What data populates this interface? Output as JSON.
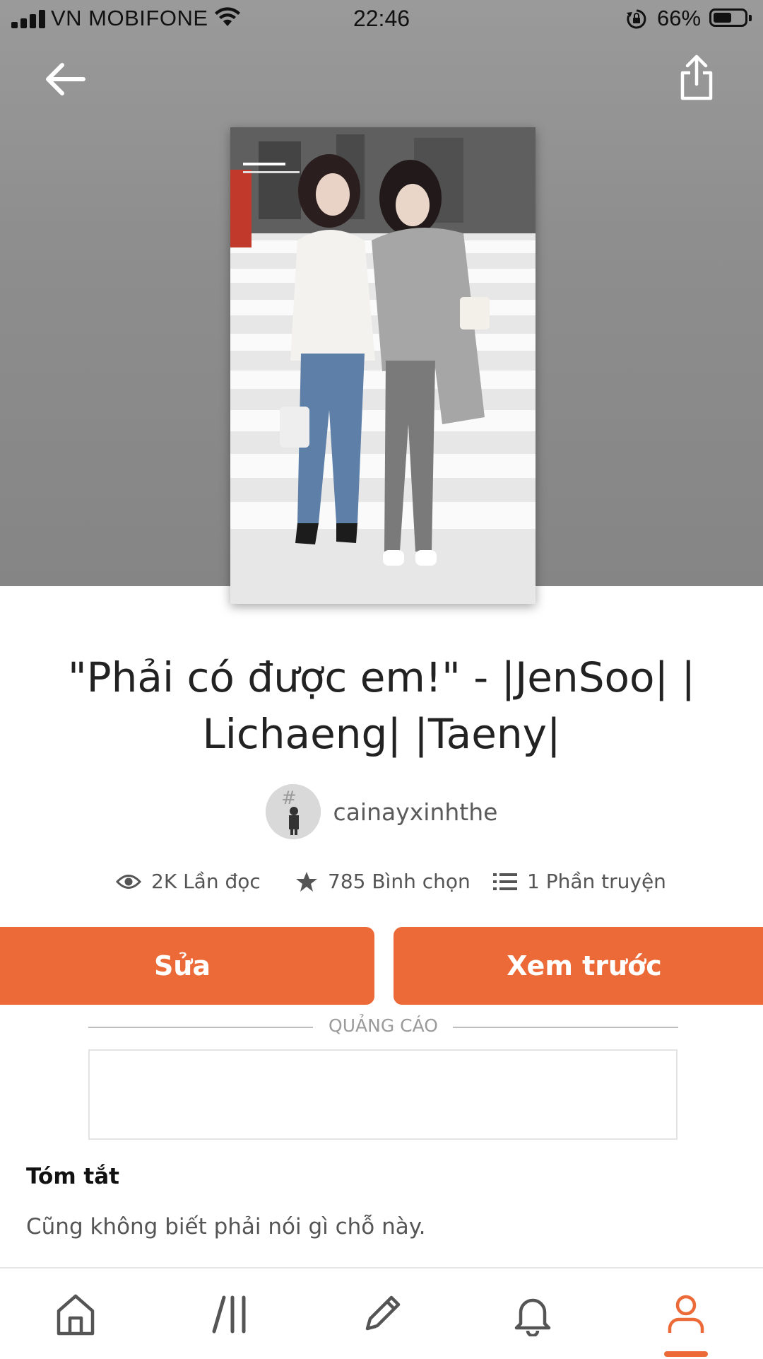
{
  "status_bar": {
    "carrier": "VN MOBIFONE",
    "time": "22:46",
    "battery_percent": "66%",
    "battery_level": 0.66
  },
  "story": {
    "title": "\"Phải có được em!\" - |JenSoo| | Lichaeng| |Taeny|",
    "author": "cainayxinhthe",
    "stats": {
      "reads": "2K Lần đọc",
      "votes": "785 Bình chọn",
      "parts": "1 Phần truyện"
    }
  },
  "actions": {
    "edit_label": "Sửa",
    "preview_label": "Xem trước"
  },
  "ad": {
    "label": "QUẢNG CÁO"
  },
  "summary": {
    "heading": "Tóm tắt",
    "text": "Cũng không biết phải nói gì chỗ này."
  },
  "icons": {
    "back": "back-arrow-icon",
    "share": "share-icon",
    "reads": "eye-icon",
    "votes": "star-icon",
    "parts": "list-icon"
  },
  "tabbar": {
    "items": [
      "home-icon",
      "library-icon",
      "write-icon",
      "notifications-icon",
      "profile-icon"
    ],
    "active": "profile-icon"
  },
  "colors": {
    "accent": "#ec6a37",
    "hero_bg": "#8e8e8e"
  }
}
